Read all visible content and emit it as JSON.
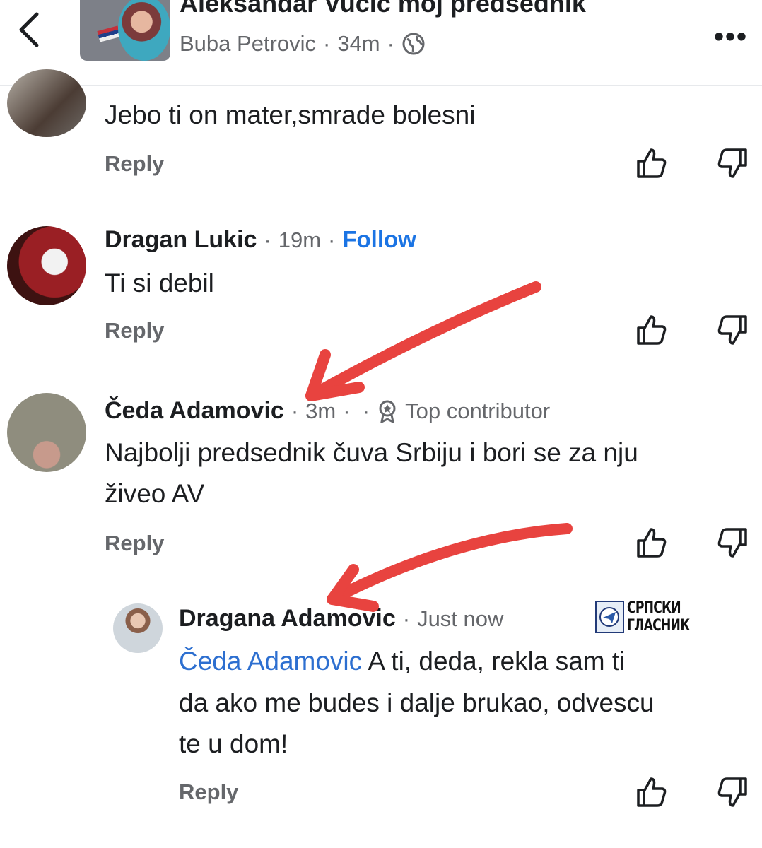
{
  "header": {
    "group_title": "Aleksandar Vucic moj predsednik",
    "author": "Buba Petrovic",
    "time": "34m",
    "icons": [
      "back-icon",
      "globe-icon",
      "more-icon"
    ]
  },
  "comments": [
    {
      "text": "Jebo ti on mater,smrade bolesni",
      "reply_label": "Reply"
    },
    {
      "name": "Dragan Lukic",
      "time": "19m",
      "follow_label": "Follow",
      "text": "Ti si debil",
      "reply_label": "Reply"
    },
    {
      "name": "Čeda Adamovic",
      "time": "3m",
      "badge": "Top contributor",
      "text_lines": [
        "Najbolji predsednik čuva Srbiju i bori se za nju",
        "živeo AV"
      ],
      "reply_label": "Reply"
    },
    {
      "name": "Dragana Adamovic",
      "time": "Just now",
      "mention": "Čeda Adamovic",
      "text_lines": [
        " A ti, deda, rekla sam ti",
        "da ako me budes i dalje brukao, odvescu",
        "te u dom!"
      ],
      "reply_label": "Reply"
    }
  ],
  "watermark": {
    "text": "СРПСКИ ГЛАСНИК"
  },
  "colors": {
    "arrow": "#e8433f",
    "link": "#1b74e4",
    "meta": "#65676b"
  }
}
